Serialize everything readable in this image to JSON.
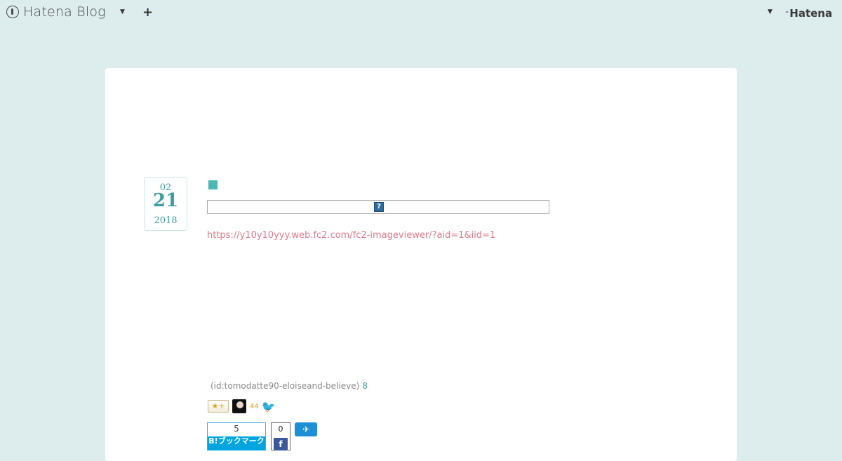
{
  "topbar": {
    "brand": "Hatena Blog",
    "dropdown_icon": "caret-down",
    "plus_icon": "plus",
    "right_dropdown_icon": "caret-down",
    "hatena_label": "Hatena"
  },
  "entry": {
    "date": {
      "month": "02",
      "day": "21",
      "year": "2018"
    },
    "link_text": "https://y10y10yyy.web.fc2.com/fc2-imageviewer/?aid=1&iid=1",
    "broken_image_glyph": "?",
    "author": "(id:tomodatte90-eloiseand-believe)",
    "author_count": "8"
  },
  "stars": {
    "add_label": "★+",
    "count": "44"
  },
  "share": {
    "hatebu_count": "5",
    "hatebu_label": "B!ブックマーク",
    "facebook_count": "0",
    "facebook_glyph": "f",
    "twitter_glyph": "🐦"
  }
}
